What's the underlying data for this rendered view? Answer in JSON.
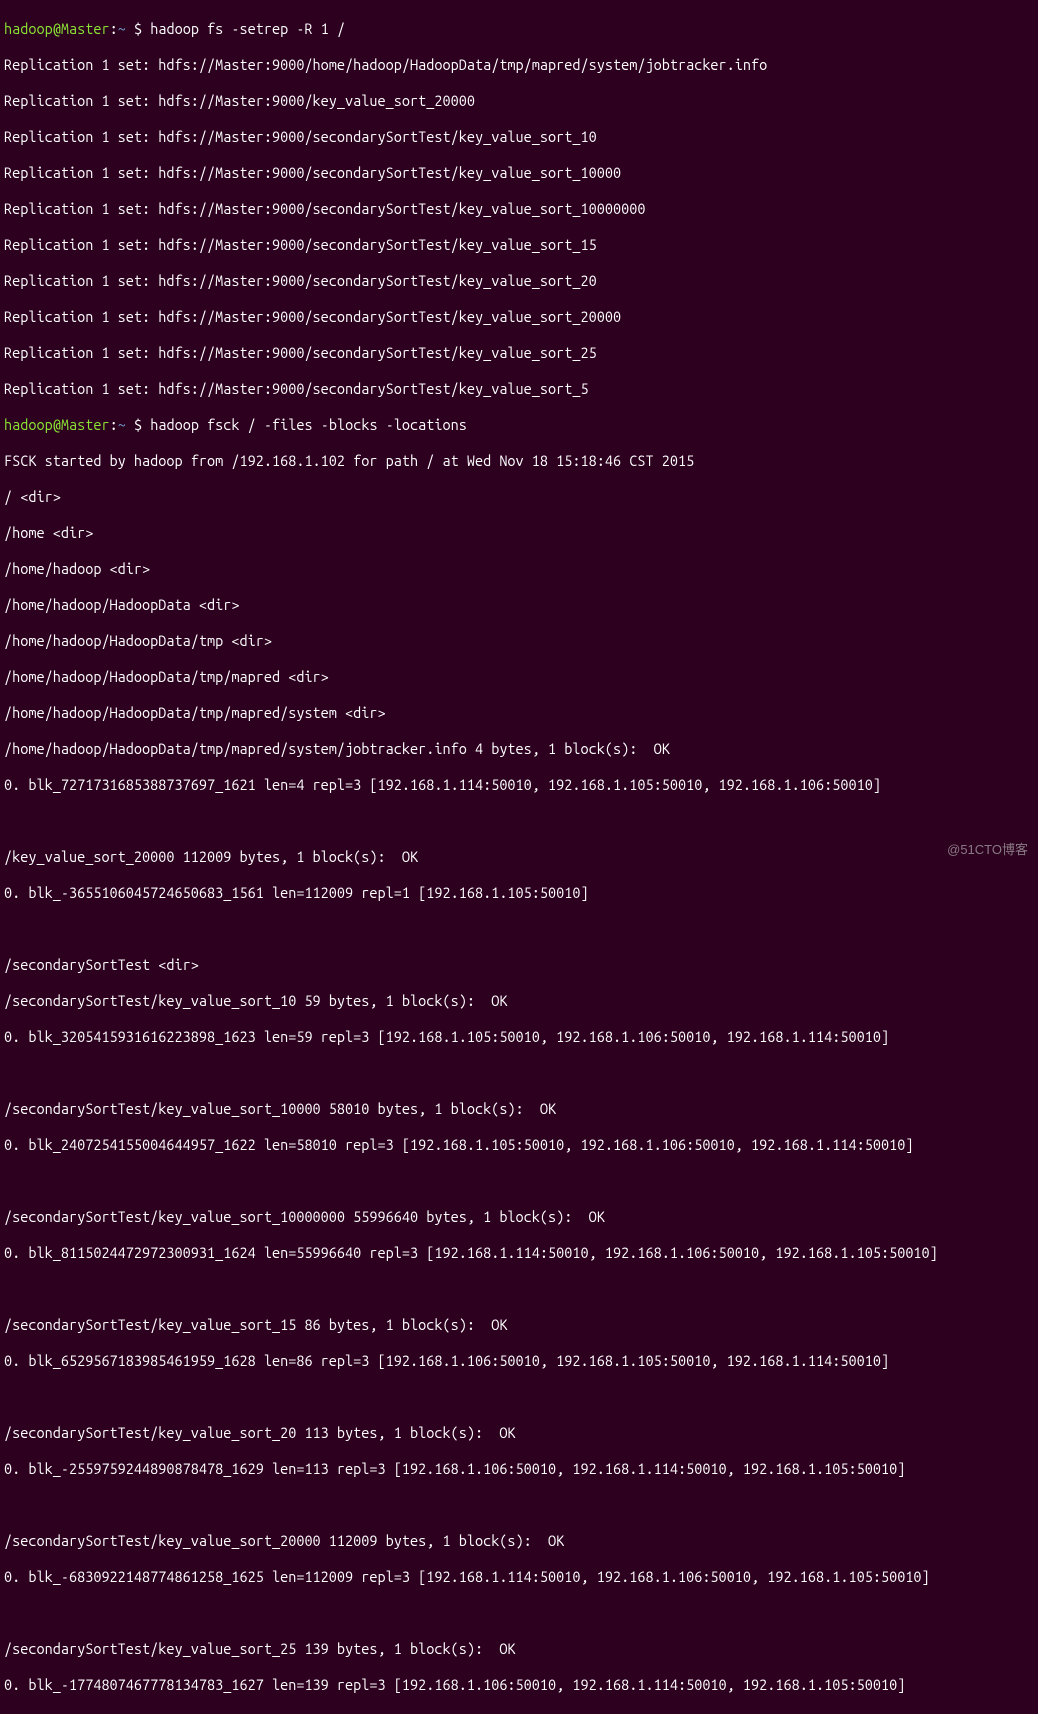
{
  "prompt": {
    "user": "hadoop",
    "host": "Master",
    "path": "~",
    "symbol": "$"
  },
  "cmd1": "hadoop fs -setrep -R 1 /",
  "rep_lines": [
    "Replication 1 set: hdfs://Master:9000/home/hadoop/HadoopData/tmp/mapred/system/jobtracker.info",
    "Replication 1 set: hdfs://Master:9000/key_value_sort_20000",
    "Replication 1 set: hdfs://Master:9000/secondarySortTest/key_value_sort_10",
    "Replication 1 set: hdfs://Master:9000/secondarySortTest/key_value_sort_10000",
    "Replication 1 set: hdfs://Master:9000/secondarySortTest/key_value_sort_10000000",
    "Replication 1 set: hdfs://Master:9000/secondarySortTest/key_value_sort_15",
    "Replication 1 set: hdfs://Master:9000/secondarySortTest/key_value_sort_20",
    "Replication 1 set: hdfs://Master:9000/secondarySortTest/key_value_sort_20000",
    "Replication 1 set: hdfs://Master:9000/secondarySortTest/key_value_sort_25",
    "Replication 1 set: hdfs://Master:9000/secondarySortTest/key_value_sort_5"
  ],
  "cmd2": "hadoop fsck / -files -blocks -locations",
  "fsck_start": "FSCK started by hadoop from /192.168.1.102 for path / at Wed Nov 18 15:18:46 CST 2015",
  "dirs": [
    "/ <dir>",
    "/home <dir>",
    "/home/hadoop <dir>",
    "/home/hadoop/HadoopData <dir>",
    "/home/hadoop/HadoopData/tmp <dir>",
    "/home/hadoop/HadoopData/tmp/mapred <dir>",
    "/home/hadoop/HadoopData/tmp/mapred/system <dir>"
  ],
  "files": [
    {
      "head": "/home/hadoop/HadoopData/tmp/mapred/system/jobtracker.info 4 bytes, 1 block(s):  OK",
      "blk": "0. blk_7271731685388737697_1621 len=4 repl=3 [192.168.1.114:50010, 192.168.1.105:50010, 192.168.1.106:50010]"
    },
    {
      "head": "/key_value_sort_20000 112009 bytes, 1 block(s):  OK",
      "blk": "0. blk_-3655106045724650683_1561 len=112009 repl=1 [192.168.1.105:50010]"
    }
  ],
  "sectest_dir": "/secondarySortTest <dir>",
  "sectest": [
    {
      "head": "/secondarySortTest/key_value_sort_10 59 bytes, 1 block(s):  OK",
      "blk": "0. blk_3205415931616223898_1623 len=59 repl=3 [192.168.1.105:50010, 192.168.1.106:50010, 192.168.1.114:50010]"
    },
    {
      "head": "/secondarySortTest/key_value_sort_10000 58010 bytes, 1 block(s):  OK",
      "blk": "0. blk_2407254155004644957_1622 len=58010 repl=3 [192.168.1.105:50010, 192.168.1.106:50010, 192.168.1.114:50010]"
    },
    {
      "head": "/secondarySortTest/key_value_sort_10000000 55996640 bytes, 1 block(s):  OK",
      "blk": "0. blk_8115024472972300931_1624 len=55996640 repl=3 [192.168.1.114:50010, 192.168.1.106:50010, 192.168.1.105:50010]"
    },
    {
      "head": "/secondarySortTest/key_value_sort_15 86 bytes, 1 block(s):  OK",
      "blk": "0. blk_6529567183985461959_1628 len=86 repl=3 [192.168.1.106:50010, 192.168.1.105:50010, 192.168.1.114:50010]"
    },
    {
      "head": "/secondarySortTest/key_value_sort_20 113 bytes, 1 block(s):  OK",
      "blk": "0. blk_-2559759244890878478_1629 len=113 repl=3 [192.168.1.106:50010, 192.168.1.114:50010, 192.168.1.105:50010]"
    },
    {
      "head": "/secondarySortTest/key_value_sort_20000 112009 bytes, 1 block(s):  OK",
      "blk": "0. blk_-6830922148774861258_1625 len=112009 repl=3 [192.168.1.114:50010, 192.168.1.106:50010, 192.168.1.105:50010]"
    },
    {
      "head": "/secondarySortTest/key_value_sort_25 139 bytes, 1 block(s):  OK",
      "blk": "0. blk_-1774807467778134783_1627 len=139 repl=3 [192.168.1.106:50010, 192.168.1.114:50010, 192.168.1.105:50010]"
    }
  ],
  "watermark": "@51CTO博客"
}
